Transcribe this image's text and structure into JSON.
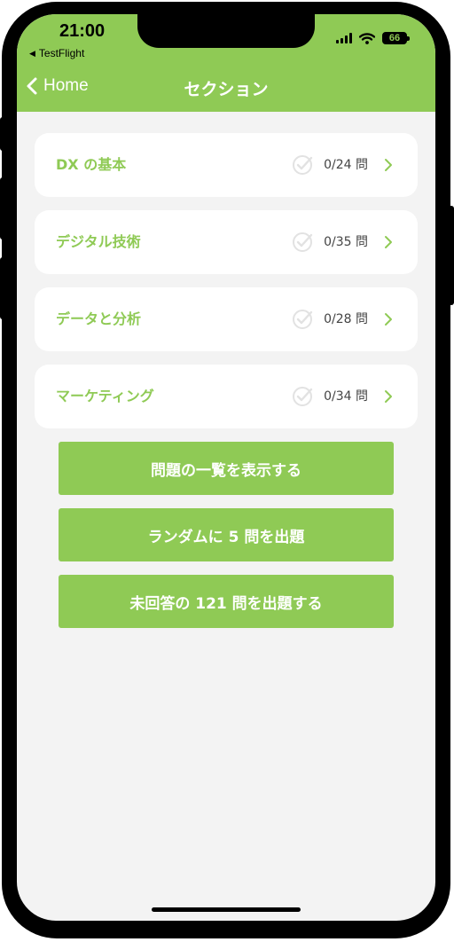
{
  "status_bar": {
    "time": "21:00",
    "back_app": "TestFlight",
    "back_app_icon": "back-triangle-icon",
    "battery_level": "66",
    "signal_icon": "cellular-signal-icon",
    "wifi_icon": "wifi-icon"
  },
  "nav": {
    "back_label": "Home",
    "title": "セクション"
  },
  "sections": [
    {
      "label": "DX の基本",
      "count": "0/24 問"
    },
    {
      "label": "デジタル技術",
      "count": "0/35 問"
    },
    {
      "label": "データと分析",
      "count": "0/28 問"
    },
    {
      "label": "マーケティング",
      "count": "0/34 問"
    }
  ],
  "actions": {
    "list_all": "問題の一覧を表示する",
    "random_five": "ランダムに 5 問を出題",
    "unanswered": "未回答の 121 問を出題する"
  },
  "colors": {
    "accent": "#8fca55",
    "background": "#f3f3f3",
    "card": "#ffffff",
    "count_text": "#444444"
  }
}
